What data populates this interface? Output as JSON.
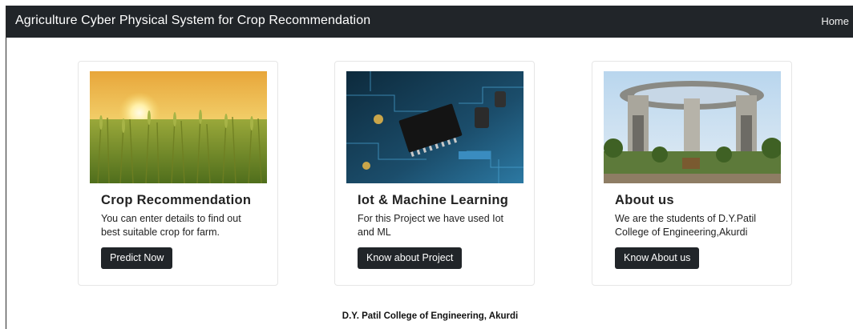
{
  "navbar": {
    "brand": "Agriculture Cyber Physical System for Crop Recommendation",
    "home_link": "Home"
  },
  "cards": [
    {
      "title": "Crop Recommendation",
      "text": "You can enter details to find out best suitable crop for farm.",
      "button": "Predict Now",
      "image_icon": "wheat-field-sunset-image"
    },
    {
      "title": "Iot & Machine Learning",
      "text": "For this Project we have used Iot and ML",
      "button": "Know about Project",
      "image_icon": "circuit-board-image"
    },
    {
      "title": "About us",
      "text": "We are the students of D.Y.Patil College of Engineering,Akurdi",
      "button": "Know About us",
      "image_icon": "university-gate-image"
    }
  ],
  "footer": {
    "text": "D.Y. Patil College of Engineering, Akurdi"
  },
  "colors": {
    "navbar_bg": "#212529",
    "button_bg": "#212529",
    "text": "#222222"
  }
}
